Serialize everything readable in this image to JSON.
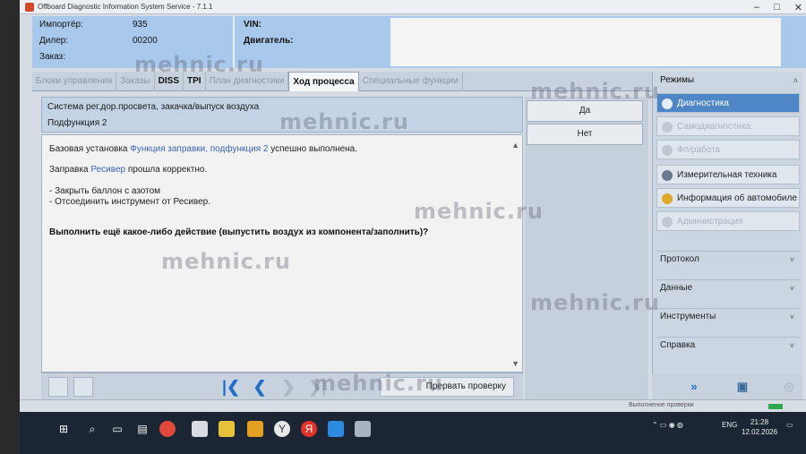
{
  "window": {
    "title": "Offboard Diagnostic Information System Service - 7.1.1"
  },
  "header": {
    "importer_label": "Импортёр:",
    "importer_value": "935",
    "dealer_label": "Дилер:",
    "dealer_value": "00200",
    "order_label": "Заказ:",
    "vin_label": "VIN:",
    "engine_label": "Двигатель:"
  },
  "tabs": [
    {
      "label": "Блоки управления"
    },
    {
      "label": "Заказы"
    },
    {
      "label": "DISS"
    },
    {
      "label": "TPI"
    },
    {
      "label": "План диагностики"
    },
    {
      "label": "Ход процесса"
    },
    {
      "label": "Специальные функции"
    }
  ],
  "system": {
    "line1": "Система рег.дор.просвета, закачка/выпуск воздуха",
    "line2": "Подфункция 2"
  },
  "message": {
    "l1_a": "Базовая установка ",
    "l1_link": "Функция заправки, подфункция 2",
    "l1_b": " успешно выполнена.",
    "l2_a": "Заправка ",
    "l2_link": "Ресивер",
    "l2_b": " прошла корректно.",
    "l3": "- Закрыть баллон с азотом",
    "l4": "- Отсоединить инструмент от Ресивер.",
    "question": "Выполнить ещё какое-либо действие (выпустить воздух из компонента/заполнить)?"
  },
  "answers": {
    "yes": "Да",
    "no": "Нет"
  },
  "toolbar": {
    "check_button": "Прервать проверку"
  },
  "sidebar": {
    "header": "Режимы",
    "items": [
      {
        "label": "Диагностика",
        "icon": "stethoscope-icon"
      },
      {
        "label": "Самодиагностика",
        "icon": "gear-icon"
      },
      {
        "label": "Фл/работа",
        "icon": "flash-icon"
      },
      {
        "label": "Измерительная техника",
        "icon": "meter-icon"
      },
      {
        "label": "Информация об автомобиле",
        "icon": "info-icon"
      },
      {
        "label": "Администрация",
        "icon": "admin-icon"
      }
    ],
    "sections": [
      {
        "label": "Протокол"
      },
      {
        "label": "Данные"
      },
      {
        "label": "Инструменты"
      },
      {
        "label": "Справка"
      }
    ]
  },
  "status": {
    "text": "Выполнение проверки"
  },
  "taskbar": {
    "lang": "ENG",
    "time": "21:28",
    "date": "12.02.2026"
  },
  "watermark": "mehnic.ru",
  "colors": {
    "accent": "#4f86c6",
    "header_bg": "#a8c8ec",
    "nav_blue": "#1f6fc4"
  }
}
